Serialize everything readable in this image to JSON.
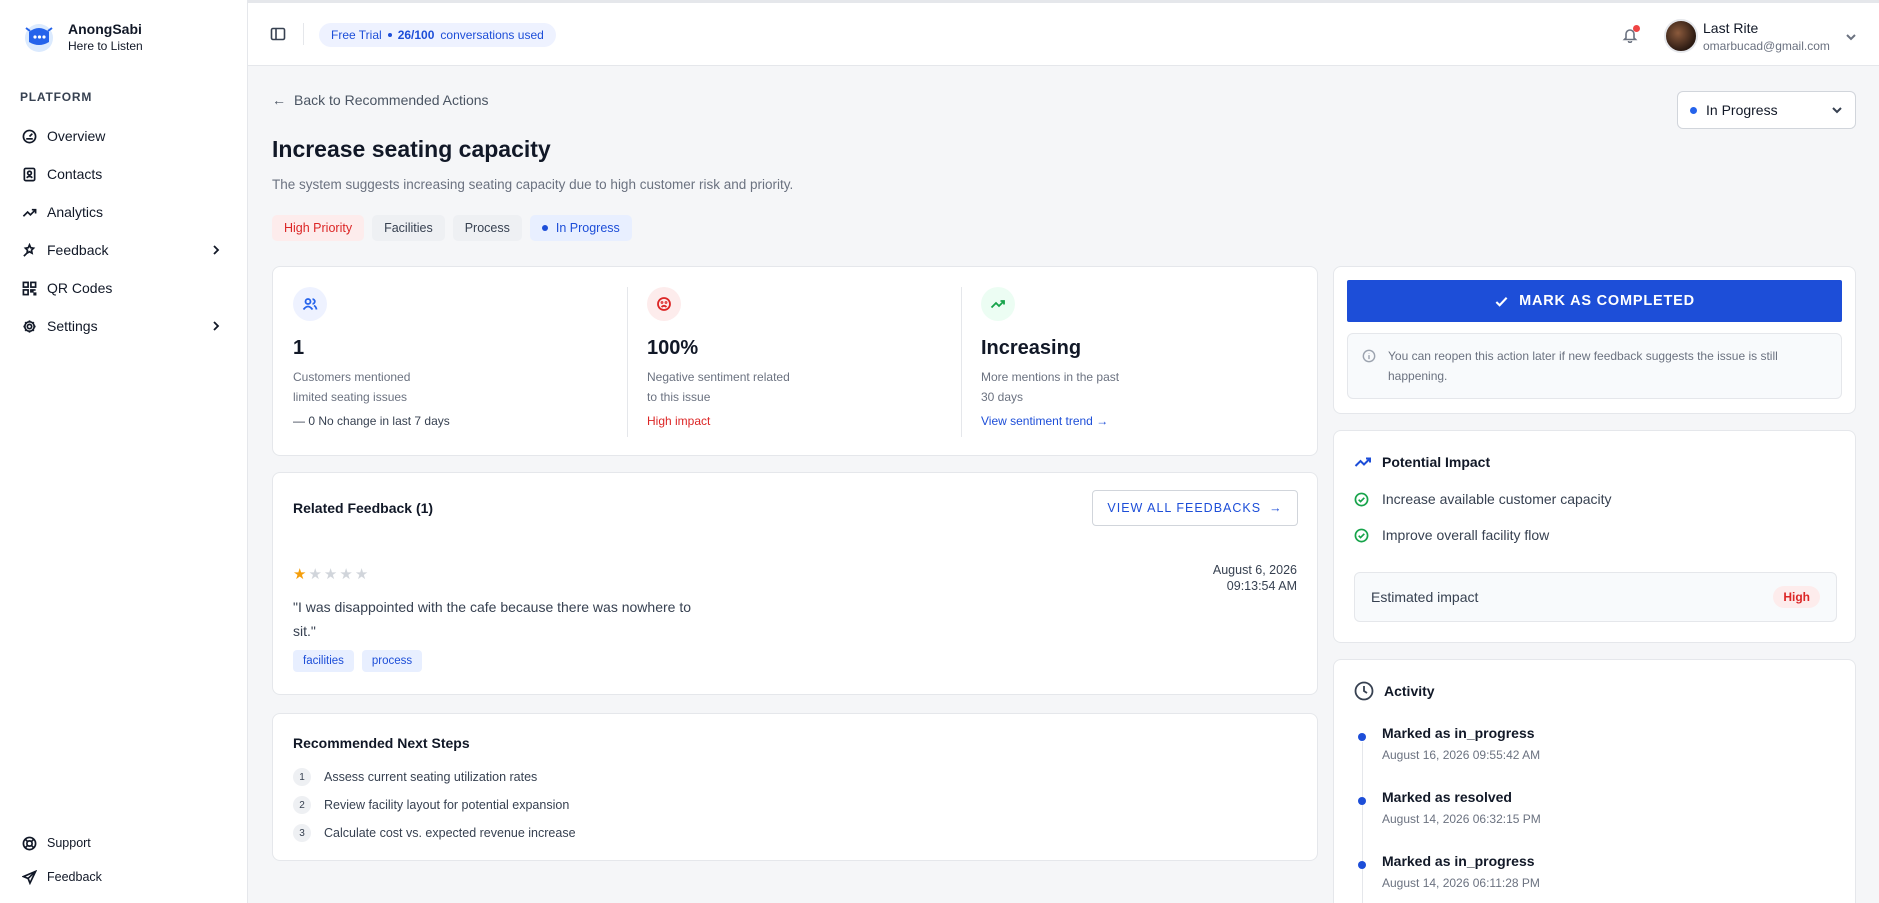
{
  "brand": {
    "name": "AnongSabi",
    "tagline": "Here to Listen"
  },
  "sidebar": {
    "section": "PLATFORM",
    "items": [
      {
        "label": "Overview",
        "icon": "gauge-icon"
      },
      {
        "label": "Contacts",
        "icon": "contact-icon"
      },
      {
        "label": "Analytics",
        "icon": "trend-icon"
      },
      {
        "label": "Feedback",
        "icon": "feedback-icon",
        "expandable": true
      },
      {
        "label": "QR Codes",
        "icon": "qr-icon"
      },
      {
        "label": "Settings",
        "icon": "gear-icon",
        "expandable": true
      }
    ],
    "bottom": [
      {
        "label": "Support",
        "icon": "support-icon"
      },
      {
        "label": "Feedback",
        "icon": "send-icon"
      }
    ]
  },
  "header": {
    "plan": "Free Trial",
    "usage_count": "26/100",
    "usage_text": "conversations used",
    "user_name": "Last Rite",
    "user_email": "omarbucad@gmail.com"
  },
  "main": {
    "back_label": "Back to Recommended Actions",
    "status_value": "In Progress",
    "title": "Increase seating capacity",
    "subtitle": "The system suggests increasing seating capacity due to high customer risk and priority.",
    "chips": [
      "High Priority",
      "Facilities",
      "Process",
      "In Progress"
    ]
  },
  "stats": [
    {
      "value": "1",
      "desc": "Customers mentioned limited seating issues",
      "foot": "0 No change in last 7 days",
      "foot_prefix": "—"
    },
    {
      "value": "100%",
      "desc": "Negative sentiment related to this issue",
      "foot": "High impact"
    },
    {
      "value": "Increasing",
      "desc": "More mentions in the past 30 days",
      "foot": "View sentiment trend"
    }
  ],
  "related": {
    "title": "Related Feedback (1)",
    "view_all": "VIEW ALL FEEDBACKS",
    "rating": 1,
    "rating_max": 5,
    "date": "August 6, 2026",
    "time": "09:13:54 AM",
    "text": "\"I was disappointed with the cafe because there was nowhere to sit.\"",
    "tags": [
      "facilities",
      "process"
    ]
  },
  "steps": {
    "title": "Recommended Next Steps",
    "items": [
      {
        "num": "1",
        "text": "Assess current seating utilization rates"
      },
      {
        "num": "2",
        "text": "Review facility layout for potential expansion"
      },
      {
        "num": "3",
        "text": "Calculate cost vs. expected revenue increase"
      }
    ]
  },
  "complete": {
    "button": "MARK AS COMPLETED",
    "note": "You can reopen this action later if new feedback suggests the issue is still happening."
  },
  "impact": {
    "title": "Potential Impact",
    "items": [
      "Increase available customer capacity",
      "Improve overall facility flow"
    ],
    "estimate_label": "Estimated impact",
    "estimate_value": "High"
  },
  "activity": {
    "title": "Activity",
    "items": [
      {
        "label": "Marked as in_progress",
        "time": "August 16, 2026 09:55:42 AM"
      },
      {
        "label": "Marked as resolved",
        "time": "August 14, 2026 06:32:15 PM"
      },
      {
        "label": "Marked as in_progress",
        "time": "August 14, 2026 06:11:28 PM"
      }
    ]
  },
  "colors": {
    "accent": "#1d4ed8",
    "danger": "#dc2626",
    "success": "#16a34a"
  }
}
